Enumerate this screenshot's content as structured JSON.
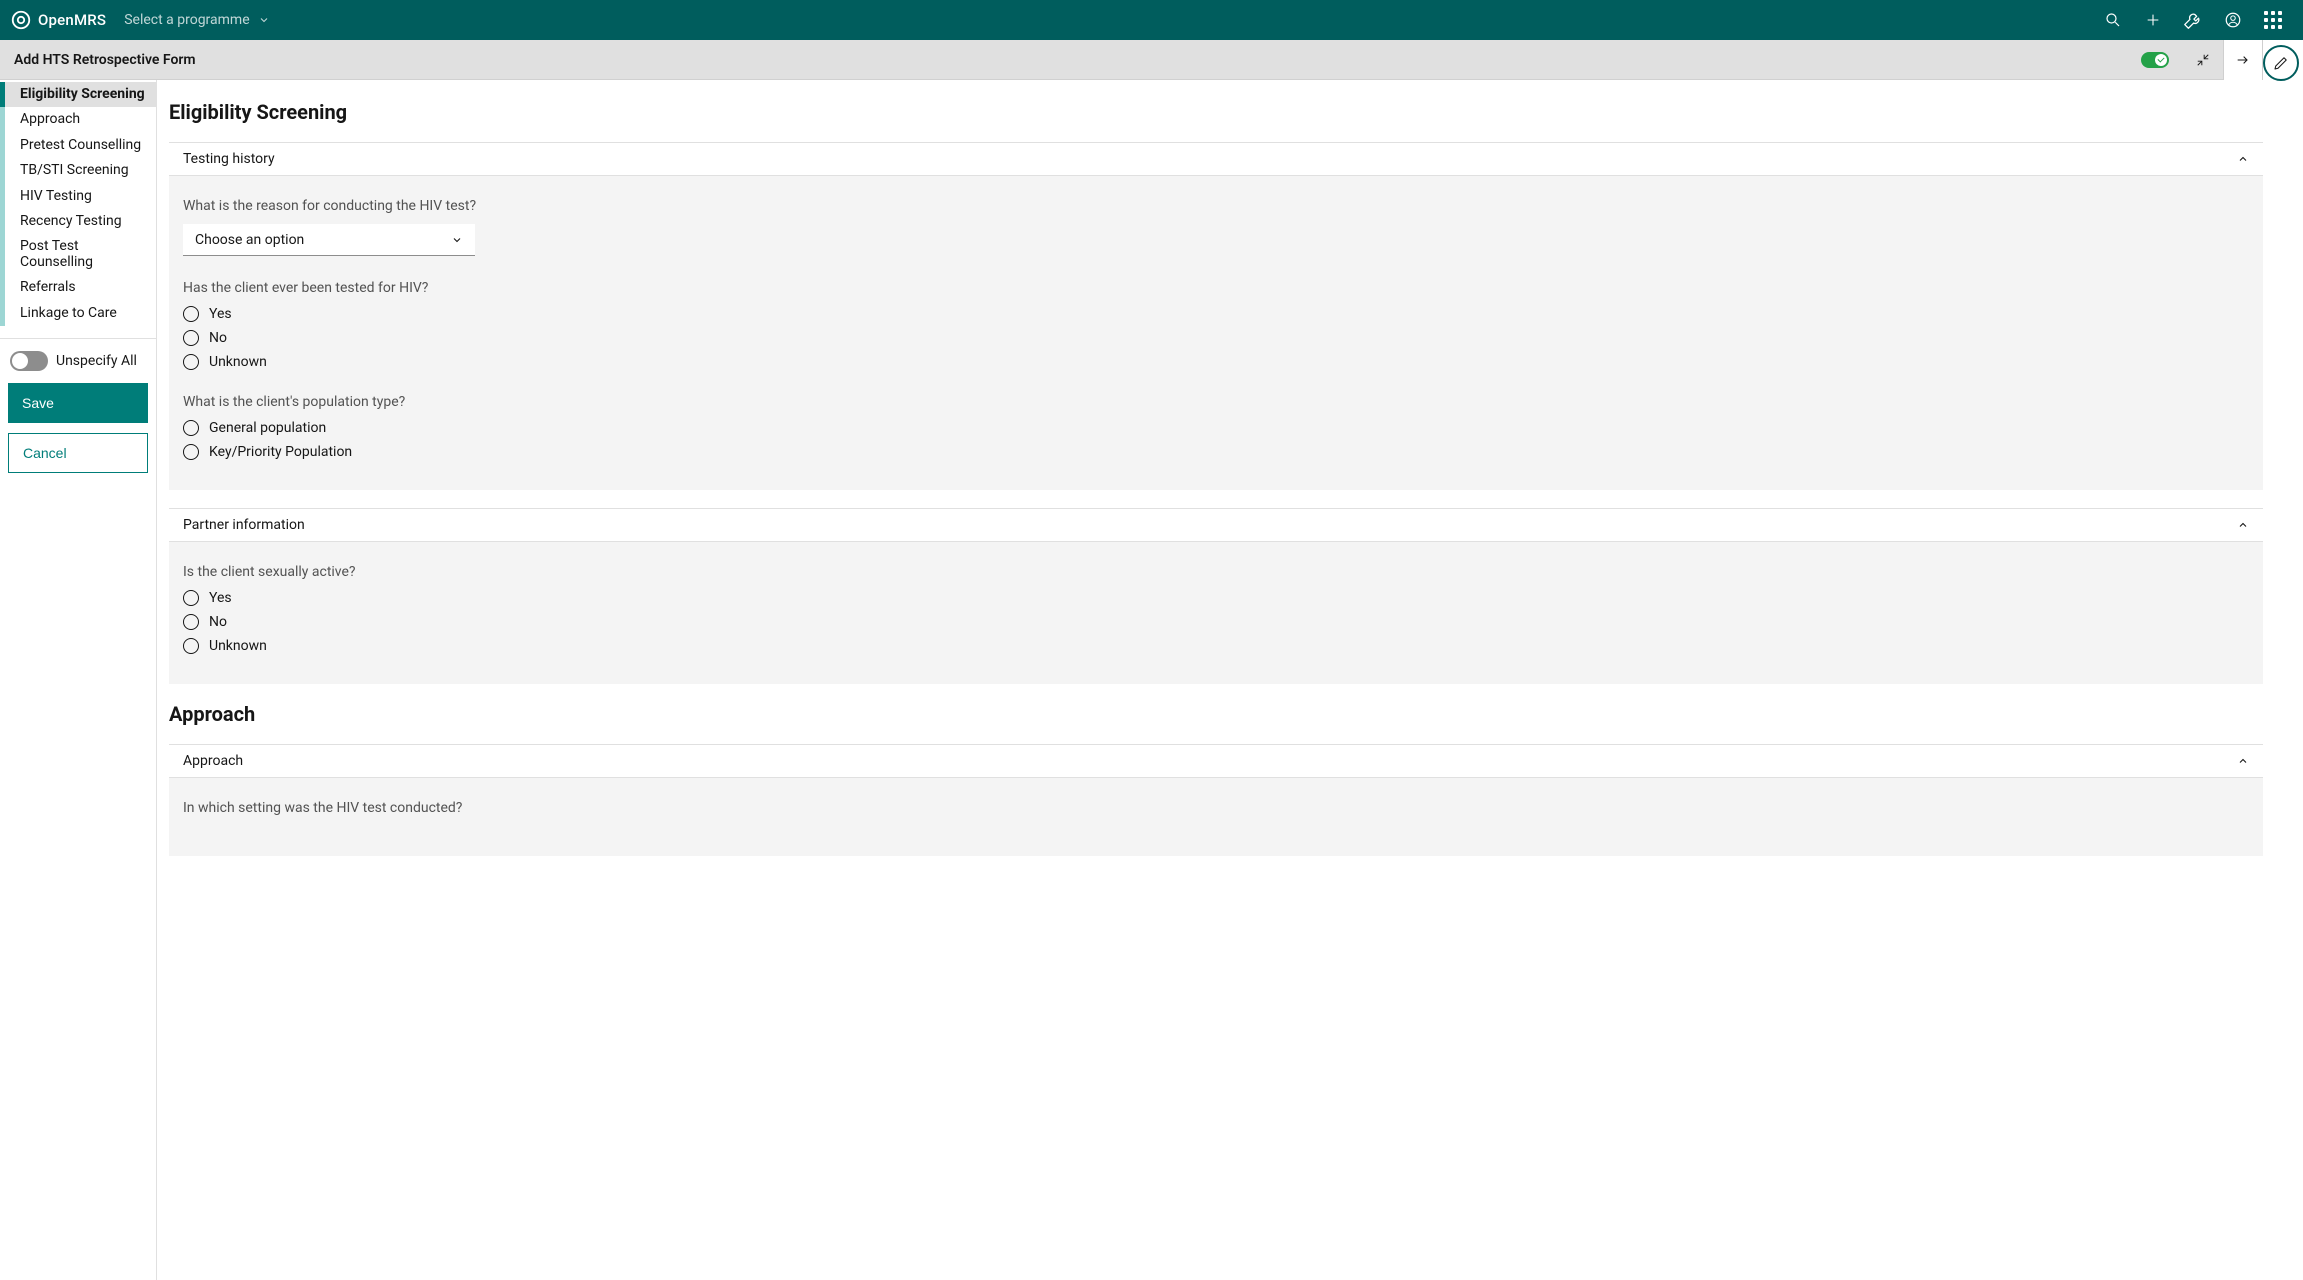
{
  "brand": {
    "name": "OpenMRS"
  },
  "program_selector": {
    "label": "Select a programme"
  },
  "subheader": {
    "title": "Add HTS Retrospective Form"
  },
  "sidebar": {
    "items": [
      {
        "label": "Eligibility Screening",
        "active": true
      },
      {
        "label": "Approach",
        "active": false
      },
      {
        "label": "Pretest Counselling",
        "active": false
      },
      {
        "label": "TB/STI Screening",
        "active": false
      },
      {
        "label": "HIV Testing",
        "active": false
      },
      {
        "label": "Recency Testing",
        "active": false
      },
      {
        "label": "Post Test Counselling",
        "active": false
      },
      {
        "label": "Referrals",
        "active": false
      },
      {
        "label": "Linkage to Care",
        "active": false
      }
    ],
    "unspecify_label": "Unspecify All",
    "save_label": "Save",
    "cancel_label": "Cancel"
  },
  "sections": {
    "eligibility": {
      "title": "Eligibility Screening",
      "testing_history": {
        "header": "Testing history",
        "q_reason": {
          "label": "What is the reason for conducting the HIV test?",
          "placeholder": "Choose an option"
        },
        "q_tested_before": {
          "label": "Has the client ever been tested for HIV?",
          "options": {
            "yes": "Yes",
            "no": "No",
            "unknown": "Unknown"
          }
        },
        "q_population_type": {
          "label": "What is the client's population type?",
          "options": {
            "general": "General population",
            "key": "Key/Priority Population"
          }
        }
      },
      "partner_info": {
        "header": "Partner information",
        "q_sexually_active": {
          "label": "Is the client sexually active?",
          "options": {
            "yes": "Yes",
            "no": "No",
            "unknown": "Unknown"
          }
        }
      }
    },
    "approach": {
      "title": "Approach",
      "approach_panel": {
        "header": "Approach",
        "q_setting": {
          "label": "In which setting was the HIV test conducted?"
        }
      }
    }
  }
}
